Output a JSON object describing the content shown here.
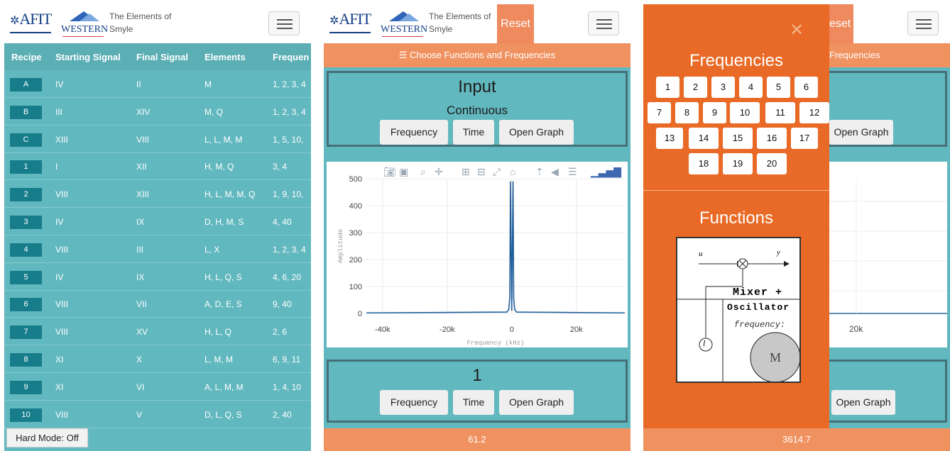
{
  "header": {
    "afit_logo": "AFIT",
    "western_logo": "WESTERN",
    "title_line1": "The Elements of",
    "title_line2": "Smyle",
    "reset_label": "Reset"
  },
  "colors": {
    "teal": "#62b8bf",
    "dark_teal_button": "#177d8b",
    "orange": "#f0925f",
    "drawer_orange": "#e96a26",
    "trace_blue": "#1f5e9a"
  },
  "recipes_table": {
    "headers": [
      "Recipe",
      "Starting Signal",
      "Final Signal",
      "Elements",
      "Frequen"
    ],
    "rows": [
      {
        "recipe": "A",
        "start": "IV",
        "final": "II",
        "elements": "M",
        "freq": "1, 2, 3, 4"
      },
      {
        "recipe": "B",
        "start": "III",
        "final": "XIV",
        "elements": "M, Q",
        "freq": "1, 2, 3, 4"
      },
      {
        "recipe": "C",
        "start": "XIII",
        "final": "VIII",
        "elements": "L, L, M, M",
        "freq": "1, 5, 10,"
      },
      {
        "recipe": "1",
        "start": "I",
        "final": "XII",
        "elements": "H, M, Q",
        "freq": "3, 4"
      },
      {
        "recipe": "2",
        "start": "VIII",
        "final": "XIII",
        "elements": "H, L, M, M, Q",
        "freq": "1, 9, 10,"
      },
      {
        "recipe": "3",
        "start": "IV",
        "final": "IX",
        "elements": "D, H, M, S",
        "freq": "4, 40"
      },
      {
        "recipe": "4",
        "start": "VIII",
        "final": "III",
        "elements": "L, X",
        "freq": "1, 2, 3, 4"
      },
      {
        "recipe": "5",
        "start": "IV",
        "final": "IX",
        "elements": "H, L, Q, S",
        "freq": "4, 6, 20"
      },
      {
        "recipe": "6",
        "start": "VIII",
        "final": "VII",
        "elements": "A, D, E, S",
        "freq": "9, 40"
      },
      {
        "recipe": "7",
        "start": "VIII",
        "final": "XV",
        "elements": "H, L, Q",
        "freq": "2, 6"
      },
      {
        "recipe": "8",
        "start": "XI",
        "final": "X",
        "elements": "L, M, M",
        "freq": "6, 9, 11"
      },
      {
        "recipe": "9",
        "start": "XI",
        "final": "VI",
        "elements": "A, L, M, M",
        "freq": "1, 4, 10"
      },
      {
        "recipe": "10",
        "start": "VIII",
        "final": "V",
        "elements": "D, L, Q, S",
        "freq": "2, 40"
      }
    ],
    "hard_mode_label": "Hard Mode: Off"
  },
  "functions_screen": {
    "choose_label": "☰ Choose Functions and Frequencies",
    "input_title": "Input",
    "input_subtitle": "Continuous",
    "frequency_btn": "Frequency",
    "time_btn": "Time",
    "open_graph_btn": "Open Graph",
    "output_title": "1",
    "bottom_value": "61.2"
  },
  "chart_data": {
    "type": "line",
    "xlabel": "Frequency (kHz)",
    "ylabel": "Amplitude",
    "xlim": [
      -45000,
      35000
    ],
    "ylim": [
      0,
      500
    ],
    "x_ticks": [
      "-40k",
      "-20k",
      "0",
      "20k"
    ],
    "y_ticks": [
      "0",
      "100",
      "200",
      "300",
      "400",
      "500"
    ],
    "series": [
      {
        "x": [
          -45000,
          -1500,
          -900,
          -600,
          -400,
          0,
          400,
          600,
          900,
          1500,
          35000
        ],
        "y": [
          2,
          5,
          15,
          60,
          490,
          10,
          490,
          60,
          15,
          5,
          2
        ]
      }
    ],
    "grid": true
  },
  "drawer": {
    "frequencies_heading": "Frequencies",
    "frequencies": [
      "1",
      "2",
      "3",
      "4",
      "5",
      "6",
      "7",
      "8",
      "9",
      "10",
      "11",
      "12",
      "13",
      "14",
      "15",
      "16",
      "17",
      "18",
      "19",
      "20"
    ],
    "functions_heading": "Functions",
    "function_card": {
      "input_label": "u",
      "output_label": "y",
      "name_line1": "Mixer +",
      "name_line2": "Oscillator",
      "param_label": "frequency:",
      "source_label": "l",
      "value_label": "M"
    },
    "bottom_value": "3614.7",
    "behind_reset": "eset",
    "behind_bar": "Frequencies",
    "behind_tick": "20k"
  }
}
